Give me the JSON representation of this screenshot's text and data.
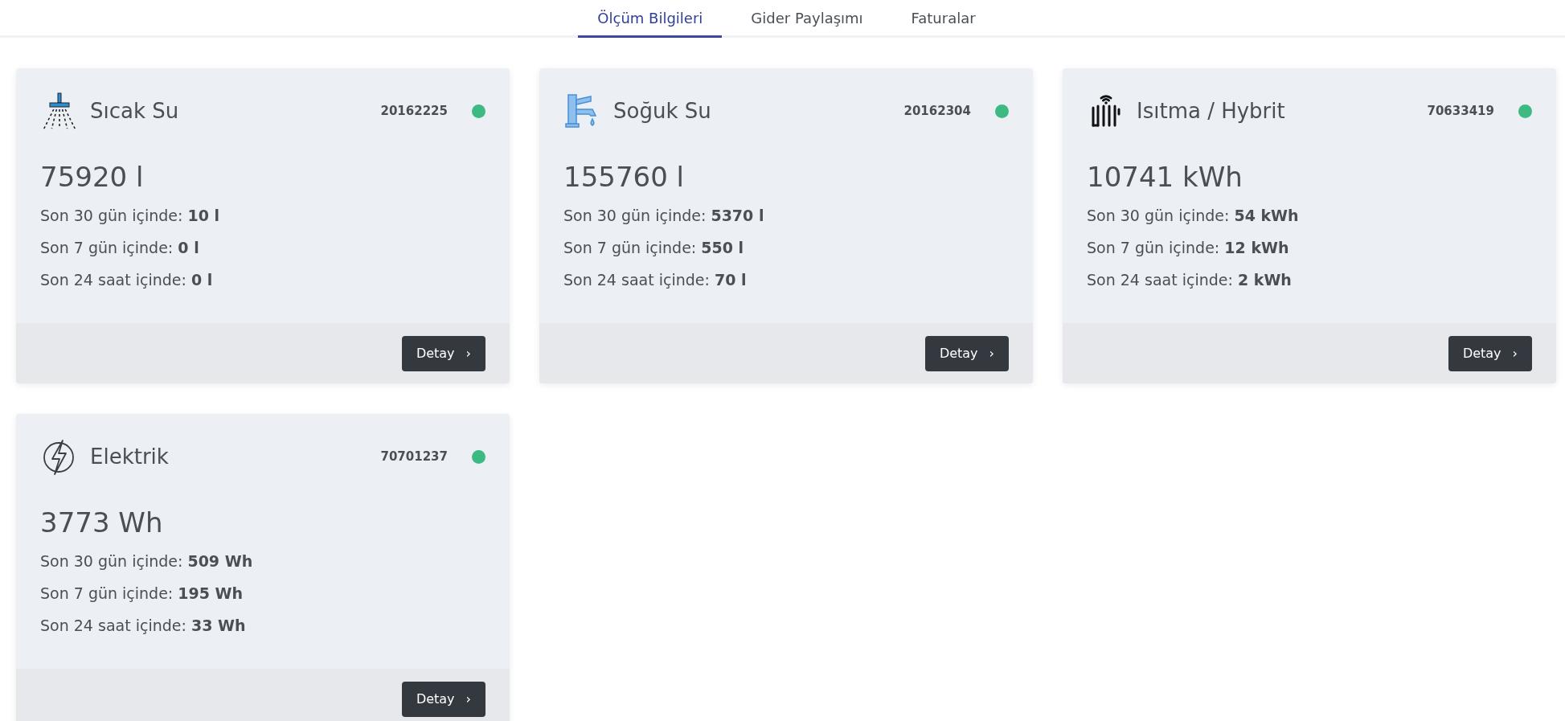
{
  "tabs": [
    {
      "label": "Ölçüm Bilgileri",
      "selected": true
    },
    {
      "label": "Gider Paylaşımı",
      "selected": false
    },
    {
      "label": "Faturalar",
      "selected": false
    }
  ],
  "meters": [
    {
      "kind": "shower",
      "title": "Sıcak Su",
      "serial": "20162225",
      "color": "#3dba82",
      "total": "75920 l",
      "stats": [
        "Son 30 gün içinde: **10 l**",
        "Son 7 gün içinde: **0 l**",
        "Son 24 saat içinde: **0 l**"
      ],
      "button": "Detay",
      "button_icon": "›"
    },
    {
      "kind": "faucet",
      "title": "Soğuk Su",
      "serial": "20162304",
      "color": "#3dba82",
      "total": "155760 l",
      "stats": [
        "Son 30 gün içinde: **5370 l**",
        "Son 7 gün içinde: **550 l**",
        "Son 24 saat içinde: **70 l**"
      ],
      "button": "Detay",
      "button_icon": "›"
    },
    {
      "kind": "radiator",
      "title": "Isıtma / Hybrit",
      "serial": "70633419",
      "color": "#3dba82",
      "total": "10741 kWh",
      "stats": [
        "Son 30 gün içinde: **54 kWh**",
        "Son 7 gün içinde: **12 kWh**",
        "Son 24 saat içinde: **2 kWh**"
      ],
      "button": "Detay",
      "button_icon": "›"
    },
    {
      "kind": "lightning",
      "title": "Elektrik",
      "serial": "70701237",
      "color": "#3dba82",
      "total": "3773 Wh",
      "stats": [
        "Son 30 gün içinde: **509 Wh**",
        "Son 7 gün içinde: **195 Wh**",
        "Son 24 saat içinde: **33 Wh**"
      ],
      "button": "Detay",
      "button_icon": "›"
    }
  ]
}
